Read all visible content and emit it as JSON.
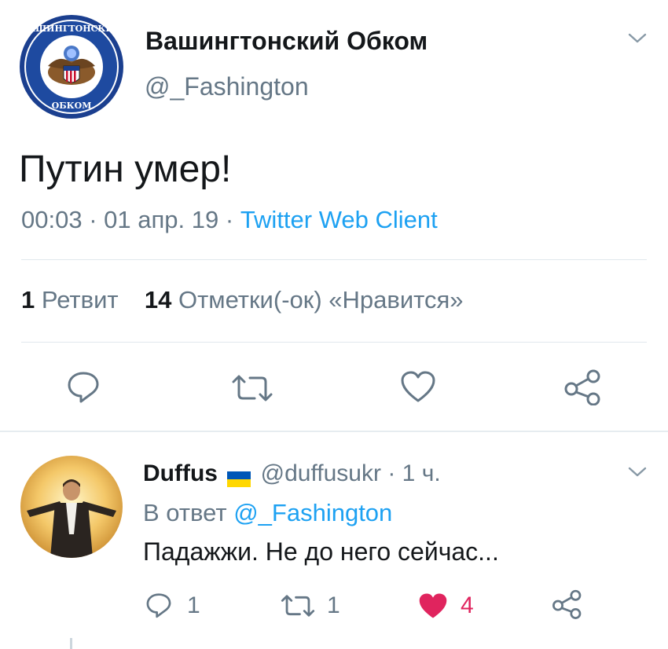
{
  "tweet": {
    "author": {
      "name": "Вашингтонский Обком",
      "handle": "@_Fashington",
      "avatar_icon": "seal-avatar-icon",
      "avatar_text_top": "ВАШИНГТОНСКИЙ",
      "avatar_text_bottom": "ОБКОМ"
    },
    "text": "Путин умер!",
    "meta": {
      "time": "00:03",
      "sep1": "·",
      "date": "01 апр. 19",
      "sep2": "·",
      "client": "Twitter Web Client"
    },
    "stats": {
      "retweets_count": "1",
      "retweets_label": "Ретвит",
      "likes_count": "14",
      "likes_label": "Отметки(-ок) «Нравится»"
    },
    "actions": [
      "reply-icon",
      "retweet-icon",
      "like-icon",
      "share-icon"
    ]
  },
  "reply": {
    "author": {
      "name": "Duffus",
      "flag_icon": "ukraine-flag-icon",
      "handle": "@duffusukr",
      "sep": "·",
      "time": "1 ч."
    },
    "in_reply_prefix": "В ответ",
    "in_reply_handle": "@_Fashington",
    "text": "Падажжи. Не до него сейчас...",
    "counts": {
      "replies": "1",
      "retweets": "1",
      "likes": "4"
    }
  },
  "colors": {
    "accent": "#1da1f2",
    "muted": "#657786",
    "like": "#e0245e",
    "divider": "#e1e8ed",
    "flag_blue": "#0057b7",
    "flag_yellow": "#ffd700"
  }
}
